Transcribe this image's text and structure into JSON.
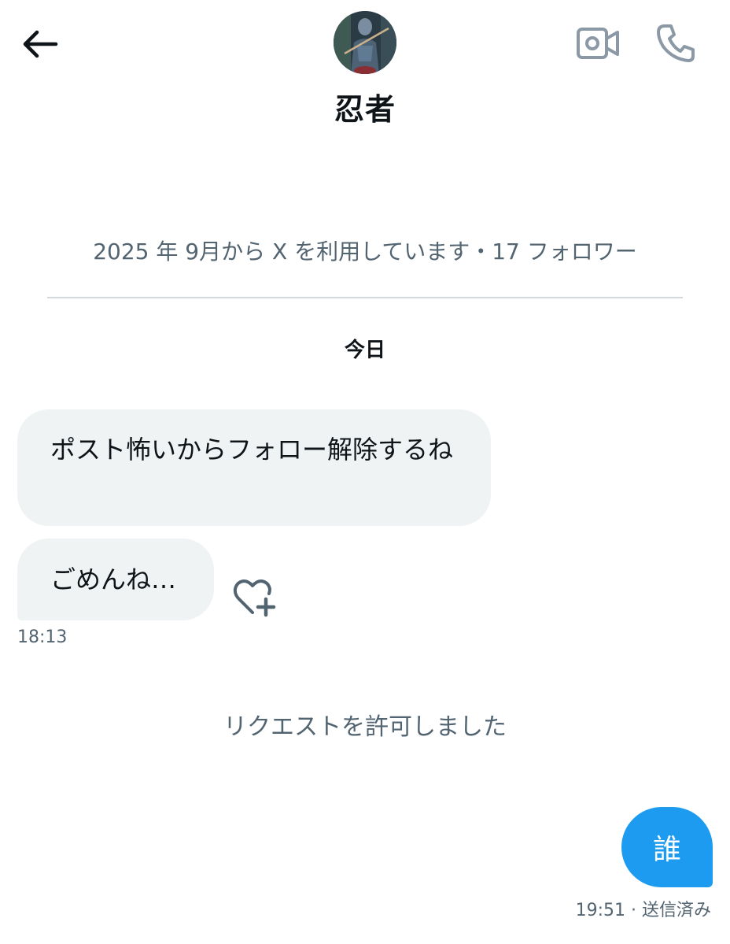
{
  "header": {
    "contact_name": "忍者",
    "avatar_icon": "ninja-avatar",
    "back_icon": "arrow-left-icon",
    "video_icon": "video-camera-icon",
    "call_icon": "phone-icon"
  },
  "profile_info": "2025 年 9月から X を利用しています・17 フォロワー",
  "day_label": "今日",
  "messages": [
    {
      "direction": "in",
      "text": "ポスト怖いからフォロー解除するね"
    },
    {
      "direction": "in",
      "text": "ごめんね…"
    }
  ],
  "incoming_time": "18:13",
  "system_message": "リクエストを許可しました",
  "outgoing": {
    "text": "誰",
    "time": "19:51",
    "status": "送信済み",
    "meta": "19:51 · 送信済み"
  },
  "colors": {
    "accent": "#1d9bf0",
    "bubble_in": "#eff3f4",
    "secondary_text": "#536471",
    "icon_gray": "#8b98a5"
  }
}
